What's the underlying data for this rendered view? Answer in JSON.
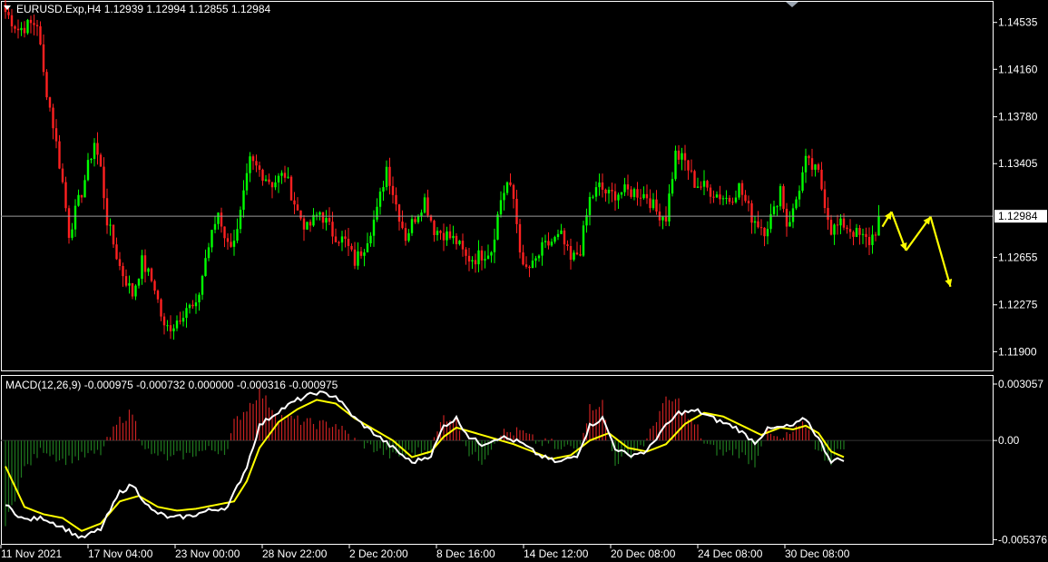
{
  "header": {
    "symbol_line": "EURUSD.Exp,H4  1.12939 1.12994 1.12855 1.12984"
  },
  "macd_header": {
    "text": "MACD(12,26,9) -0.000975 -0.000732 0.000000 -0.000316 -0.000975"
  },
  "colors": {
    "background": "#000000",
    "bull": "#00ff00",
    "bear": "#ff2020",
    "macd_line": "#ffffff",
    "signal_line": "#ffff00",
    "hist_up": "#cc2222",
    "hist_down": "#1f7a1f",
    "arrow": "#ffff00",
    "grid": "#ffffff"
  },
  "chart_data": [
    {
      "type": "candlestick",
      "symbol": "EURUSD.Exp",
      "timeframe": "H4",
      "last_price": 1.12984,
      "last_price_label": "1.12984",
      "y_ticks": [
        1.14535,
        1.1416,
        1.1378,
        1.13405,
        1.12655,
        1.12275,
        1.119
      ],
      "y_tick_labels": [
        "1.14535",
        "1.14160",
        "1.13780",
        "1.13405",
        "1.12655",
        "1.12275",
        "1.11900"
      ],
      "ylim": [
        1.1175,
        1.147
      ],
      "x_tick_labels": [
        "11 Nov 2021",
        "17 Nov 04:00",
        "23 Nov 00:00",
        "28 Nov 22:00",
        "2 Dec 20:00",
        "8 Dec 16:00",
        "14 Dec 12:00",
        "20 Dec 08:00",
        "24 Dec 08:00",
        "30 Dec 08:00"
      ],
      "close_anchors": [
        [
          0,
          1.1462
        ],
        [
          4,
          1.1448
        ],
        [
          8,
          1.1452
        ],
        [
          10,
          1.1453
        ],
        [
          12,
          1.1412
        ],
        [
          15,
          1.1372
        ],
        [
          18,
          1.1325
        ],
        [
          20,
          1.1285
        ],
        [
          24,
          1.1318
        ],
        [
          28,
          1.1358
        ],
        [
          30,
          1.1336
        ],
        [
          32,
          1.1295
        ],
        [
          36,
          1.1258
        ],
        [
          40,
          1.1236
        ],
        [
          43,
          1.1262
        ],
        [
          47,
          1.1242
        ],
        [
          50,
          1.1208
        ],
        [
          53,
          1.1212
        ],
        [
          57,
          1.1226
        ],
        [
          60,
          1.1224
        ],
        [
          63,
          1.1265
        ],
        [
          67,
          1.1302
        ],
        [
          70,
          1.1275
        ],
        [
          73,
          1.1285
        ],
        [
          77,
          1.1342
        ],
        [
          80,
          1.1335
        ],
        [
          84,
          1.1325
        ],
        [
          88,
          1.1332
        ],
        [
          92,
          1.1302
        ],
        [
          95,
          1.1288
        ],
        [
          99,
          1.1302
        ],
        [
          103,
          1.1285
        ],
        [
          107,
          1.1278
        ],
        [
          110,
          1.1262
        ],
        [
          113,
          1.1275
        ],
        [
          117,
          1.1302
        ],
        [
          120,
          1.1338
        ],
        [
          123,
          1.1308
        ],
        [
          126,
          1.1282
        ],
        [
          129,
          1.1298
        ],
        [
          132,
          1.1312
        ],
        [
          135,
          1.1288
        ],
        [
          138,
          1.1285
        ],
        [
          142,
          1.1278
        ],
        [
          145,
          1.1265
        ],
        [
          148,
          1.1265
        ],
        [
          150,
          1.1268
        ],
        [
          153,
          1.1272
        ],
        [
          156,
          1.1312
        ],
        [
          158,
          1.1325
        ],
        [
          160,
          1.1312
        ],
        [
          163,
          1.1255
        ],
        [
          166,
          1.1258
        ],
        [
          169,
          1.1272
        ],
        [
          172,
          1.1278
        ],
        [
          175,
          1.1282
        ],
        [
          178,
          1.1262
        ],
        [
          181,
          1.1272
        ],
        [
          184,
          1.1312
        ],
        [
          187,
          1.1322
        ],
        [
          190,
          1.1315
        ],
        [
          194,
          1.1318
        ],
        [
          198,
          1.1318
        ],
        [
          202,
          1.1315
        ],
        [
          205,
          1.1302
        ],
        [
          208,
          1.1298
        ],
        [
          211,
          1.1348
        ],
        [
          214,
          1.1342
        ],
        [
          217,
          1.1325
        ],
        [
          220,
          1.1322
        ],
        [
          224,
          1.1316
        ],
        [
          228,
          1.1312
        ],
        [
          231,
          1.1322
        ],
        [
          235,
          1.1298
        ],
        [
          239,
          1.1288
        ],
        [
          242,
          1.1302
        ],
        [
          244,
          1.1322
        ],
        [
          246,
          1.1292
        ],
        [
          248,
          1.1302
        ],
        [
          252,
          1.1342
        ],
        [
          256,
          1.1332
        ],
        [
          260,
          1.1288
        ],
        [
          264,
          1.1292
        ],
        [
          266,
          1.1288
        ],
        [
          269,
          1.1282
        ],
        [
          272,
          1.1278
        ],
        [
          275,
          1.1292
        ]
      ],
      "forecast_arrows": [
        [
          1.129,
          1.1302
        ],
        [
          1.1302,
          1.1271
        ],
        [
          1.1271,
          1.1298
        ],
        [
          1.1298,
          1.1242
        ]
      ]
    },
    {
      "type": "line+bar",
      "name": "MACD(12,26,9)",
      "values_shown": [
        -0.000975,
        -0.000732,
        0.0,
        -0.000316,
        -0.000975
      ],
      "y_ticks": [
        0.003057,
        0.0,
        -0.005376
      ],
      "y_tick_labels": [
        "0.003057",
        "0.00",
        "-0.005376"
      ],
      "ylim": [
        -0.0056,
        0.0035
      ],
      "macd_anchors": [
        [
          0,
          -0.0035
        ],
        [
          6,
          -0.0043
        ],
        [
          12,
          -0.0042
        ],
        [
          18,
          -0.0047
        ],
        [
          24,
          -0.0053
        ],
        [
          30,
          -0.0048
        ],
        [
          36,
          -0.0028
        ],
        [
          40,
          -0.0024
        ],
        [
          46,
          -0.0038
        ],
        [
          52,
          -0.0042
        ],
        [
          58,
          -0.0041
        ],
        [
          64,
          -0.0038
        ],
        [
          70,
          -0.0036
        ],
        [
          76,
          -0.0014
        ],
        [
          80,
          0.0008
        ],
        [
          86,
          0.0016
        ],
        [
          92,
          0.0022
        ],
        [
          98,
          0.0026
        ],
        [
          104,
          0.0024
        ],
        [
          110,
          0.0012
        ],
        [
          116,
          0.0004
        ],
        [
          122,
          -0.0004
        ],
        [
          128,
          -0.0012
        ],
        [
          134,
          -0.0008
        ],
        [
          138,
          0.0008
        ],
        [
          142,
          0.0012
        ],
        [
          146,
          0.0002
        ],
        [
          150,
          -0.0002
        ],
        [
          156,
          0.0002
        ],
        [
          162,
          -0.0001
        ],
        [
          168,
          -0.0008
        ],
        [
          174,
          -0.0012
        ],
        [
          180,
          -0.0008
        ],
        [
          184,
          0.0008
        ],
        [
          188,
          0.0012
        ],
        [
          192,
          -0.0004
        ],
        [
          196,
          -0.0008
        ],
        [
          202,
          -0.0006
        ],
        [
          206,
          0.0004
        ],
        [
          212,
          0.0015
        ],
        [
          218,
          0.0016
        ],
        [
          224,
          0.0011
        ],
        [
          230,
          0.0007
        ],
        [
          236,
          -0.0001
        ],
        [
          240,
          0.0006
        ],
        [
          244,
          0.0007
        ],
        [
          248,
          0.0008
        ],
        [
          252,
          0.0012
        ],
        [
          256,
          0.0001
        ],
        [
          260,
          -0.0011
        ],
        [
          264,
          -0.001
        ]
      ],
      "signal_anchors": [
        [
          0,
          -0.0014
        ],
        [
          6,
          -0.0036
        ],
        [
          12,
          -0.004
        ],
        [
          18,
          -0.0042
        ],
        [
          24,
          -0.0049
        ],
        [
          30,
          -0.0045
        ],
        [
          36,
          -0.0033
        ],
        [
          42,
          -0.003
        ],
        [
          48,
          -0.0036
        ],
        [
          54,
          -0.0038
        ],
        [
          60,
          -0.0037
        ],
        [
          66,
          -0.0035
        ],
        [
          72,
          -0.0033
        ],
        [
          76,
          -0.0022
        ],
        [
          80,
          -0.0004
        ],
        [
          86,
          0.001
        ],
        [
          92,
          0.0017
        ],
        [
          98,
          0.0022
        ],
        [
          104,
          0.002
        ],
        [
          110,
          0.0012
        ],
        [
          116,
          0.0006
        ],
        [
          122,
          0.0
        ],
        [
          128,
          -0.0009
        ],
        [
          134,
          -0.0006
        ],
        [
          138,
          0.0002
        ],
        [
          142,
          0.0007
        ],
        [
          148,
          0.0004
        ],
        [
          154,
          0.0001
        ],
        [
          160,
          -0.0002
        ],
        [
          166,
          -0.0006
        ],
        [
          172,
          -0.001
        ],
        [
          178,
          -0.0008
        ],
        [
          184,
          0.0
        ],
        [
          190,
          0.0004
        ],
        [
          196,
          -0.0004
        ],
        [
          202,
          -0.0006
        ],
        [
          208,
          -0.0002
        ],
        [
          214,
          0.0009
        ],
        [
          220,
          0.0015
        ],
        [
          226,
          0.0013
        ],
        [
          232,
          0.0008
        ],
        [
          238,
          0.0003
        ],
        [
          244,
          0.0007
        ],
        [
          248,
          0.0006
        ],
        [
          252,
          0.0008
        ],
        [
          256,
          0.0004
        ],
        [
          260,
          -0.0006
        ],
        [
          264,
          -0.0009
        ]
      ]
    }
  ]
}
